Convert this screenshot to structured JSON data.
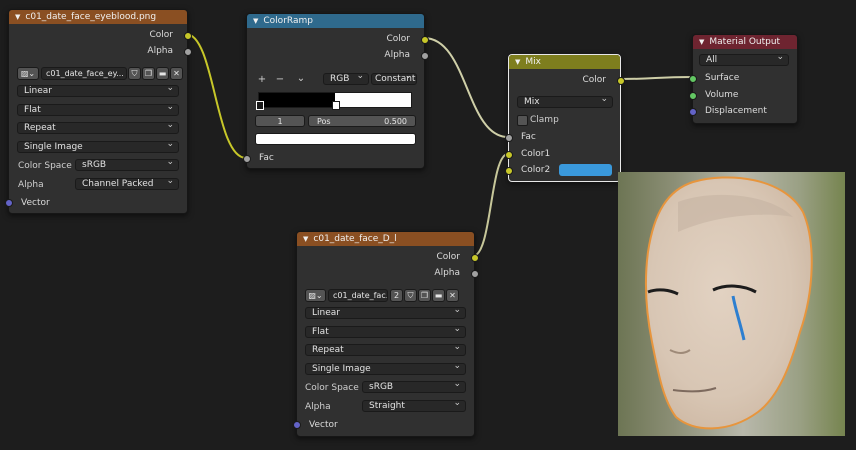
{
  "colors": {
    "socket_color": "#c7c729",
    "socket_float": "#a1a1a1",
    "socket_vector": "#6363c7",
    "socket_shader": "#63c763",
    "mix_color2": "#3a99dc"
  },
  "image_node_1": {
    "title": "c01_date_face_eyeblood.png",
    "outputs": [
      "Color",
      "Alpha"
    ],
    "image_name": "c01_date_face_ey...",
    "interpolation": "Linear",
    "projection": "Flat",
    "extension": "Repeat",
    "source": "Single Image",
    "color_space_label": "Color Space",
    "color_space": "sRGB",
    "alpha_label": "Alpha",
    "alpha": "Channel Packed",
    "input_vector": "Vector"
  },
  "color_ramp": {
    "title": "ColorRamp",
    "outputs": [
      "Color",
      "Alpha"
    ],
    "add": "+",
    "remove": "−",
    "menu": "⌄",
    "color_mode": "RGB",
    "interpolation": "Constant",
    "stop_index": "1",
    "pos_label": "Pos",
    "pos_value": "0.500",
    "input_fac": "Fac"
  },
  "mix": {
    "title": "Mix",
    "output": "Color",
    "blend": "Mix",
    "clamp": "Clamp",
    "inputs": [
      "Fac",
      "Color1",
      "Color2"
    ]
  },
  "material_output": {
    "title": "Material Output",
    "target": "All",
    "inputs": [
      "Surface",
      "Volume",
      "Displacement"
    ]
  },
  "image_node_2": {
    "title": "c01_date_face_D_l",
    "outputs": [
      "Color",
      "Alpha"
    ],
    "image_name": "c01_date_fac...",
    "users": "2",
    "interpolation": "Linear",
    "projection": "Flat",
    "extension": "Repeat",
    "source": "Single Image",
    "color_space_label": "Color Space",
    "color_space": "sRGB",
    "alpha_label": "Alpha",
    "alpha": "Straight",
    "input_vector": "Vector"
  }
}
